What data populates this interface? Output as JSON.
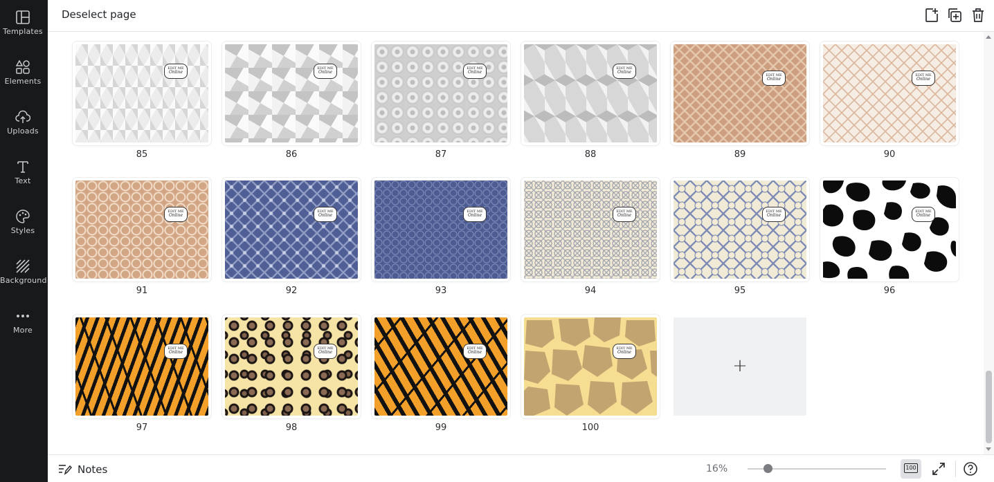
{
  "sidebar": {
    "items": [
      {
        "label": "Templates",
        "icon": "templates-icon"
      },
      {
        "label": "Elements",
        "icon": "elements-icon"
      },
      {
        "label": "Uploads",
        "icon": "uploads-icon"
      },
      {
        "label": "Text",
        "icon": "text-icon"
      },
      {
        "label": "Styles",
        "icon": "styles-icon"
      },
      {
        "label": "Background",
        "icon": "background-icon"
      },
      {
        "label": "More",
        "icon": "more-icon"
      }
    ]
  },
  "topbar": {
    "deselect_label": "Deselect page",
    "icons": [
      "add-page-icon",
      "duplicate-page-icon",
      "delete-page-icon"
    ]
  },
  "badge": {
    "line1": "EDIT ME",
    "line2": "Online"
  },
  "pages": [
    {
      "number": "85",
      "pattern": "grey-triangles"
    },
    {
      "number": "86",
      "pattern": "grey-pinwheel"
    },
    {
      "number": "87",
      "pattern": "grey-circles"
    },
    {
      "number": "88",
      "pattern": "grey-cubes"
    },
    {
      "number": "89",
      "pattern": "tan-lattice"
    },
    {
      "number": "90",
      "pattern": "cream-lattice"
    },
    {
      "number": "91",
      "pattern": "tan-geometric"
    },
    {
      "number": "92",
      "pattern": "blue-floral"
    },
    {
      "number": "93",
      "pattern": "blue-stars"
    },
    {
      "number": "94",
      "pattern": "cream-star-tiles"
    },
    {
      "number": "95",
      "pattern": "blue-star-tiles"
    },
    {
      "number": "96",
      "pattern": "cow-print"
    },
    {
      "number": "97",
      "pattern": "tiger-stripe"
    },
    {
      "number": "98",
      "pattern": "leopard-print"
    },
    {
      "number": "99",
      "pattern": "tiger-stripe-2"
    },
    {
      "number": "100",
      "pattern": "giraffe-print"
    }
  ],
  "add_page": {
    "symbol": "+"
  },
  "bottombar": {
    "notes_label": "Notes",
    "zoom_percent": "16%",
    "zoom_level": 0.16,
    "page_view_label": "100",
    "icons": [
      "notes-icon",
      "fullscreen-icon",
      "help-icon"
    ]
  },
  "colors": {
    "sidebar_bg": "#18191b",
    "page_tan": "#cc9f7e",
    "page_blue": "#4f5f95",
    "tiger_orange": "#f3a02b",
    "giraffe_yellow": "#f5dd92"
  }
}
